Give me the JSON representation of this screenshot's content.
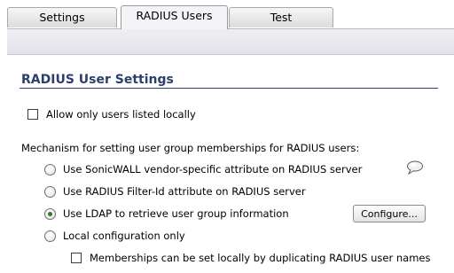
{
  "tabs": [
    {
      "label": "Settings",
      "active": false
    },
    {
      "label": "RADIUS Users",
      "active": true
    },
    {
      "label": "Test",
      "active": false
    }
  ],
  "section": {
    "title": "RADIUS User Settings"
  },
  "options": {
    "allow_local_only": {
      "label": "Allow only users listed locally",
      "checked": false
    },
    "mechanism_heading": "Mechanism for setting user group memberships for RADIUS users:",
    "radios": [
      {
        "label": "Use SonicWALL vendor-specific attribute on RADIUS server",
        "selected": false
      },
      {
        "label": "Use RADIUS Filter-Id attribute on RADIUS server",
        "selected": false
      },
      {
        "label": "Use LDAP to retrieve user group information",
        "selected": true
      },
      {
        "label": "Local configuration only",
        "selected": false
      }
    ],
    "memberships_local": {
      "label": "Memberships can be set locally by duplicating RADIUS user names",
      "checked": false
    }
  },
  "buttons": {
    "configure": "Configure..."
  },
  "icons": {
    "tooltip": "speech-bubble-icon"
  },
  "colors": {
    "title": "#2b3f6a",
    "radio_selected": "#2a7a2a"
  }
}
